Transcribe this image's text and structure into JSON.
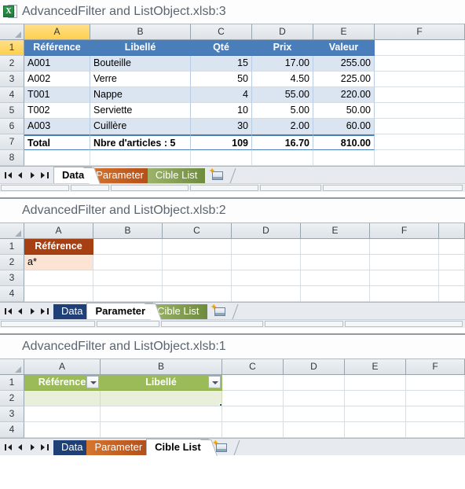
{
  "app": {
    "icon": "excel-workbook-icon"
  },
  "panels": [
    {
      "title": "AdvancedFilter and ListObject.xlsb:3",
      "columns": [
        "A",
        "B",
        "C",
        "D",
        "E",
        "F"
      ],
      "rows": [
        "1",
        "2",
        "3",
        "4",
        "5",
        "6",
        "7",
        "8"
      ],
      "table": {
        "headers": [
          "Référence",
          "Libellé",
          "Qté",
          "Prix",
          "Valeur"
        ],
        "data": [
          [
            "A001",
            "Bouteille",
            "15",
            "17.00",
            "255.00"
          ],
          [
            "A002",
            "Verre",
            "50",
            "4.50",
            "225.00"
          ],
          [
            "T001",
            "Nappe",
            "4",
            "55.00",
            "220.00"
          ],
          [
            "T002",
            "Serviette",
            "10",
            "5.00",
            "50.00"
          ],
          [
            "A003",
            "Cuillère",
            "30",
            "2.00",
            "60.00"
          ]
        ],
        "total": [
          "Total",
          "Nbre d'articles :  5",
          "109",
          "16.70",
          "810.00"
        ]
      },
      "tabs": [
        {
          "label": "Data",
          "state": "active"
        },
        {
          "label": "Parameter",
          "state": "orange"
        },
        {
          "label": "Cible List",
          "state": "green"
        }
      ]
    },
    {
      "title": "AdvancedFilter and ListObject.xlsb:2",
      "columns": [
        "A",
        "B",
        "C",
        "D",
        "E",
        "F"
      ],
      "rows": [
        "1",
        "2",
        "3",
        "4"
      ],
      "criteria": {
        "header": "Référence",
        "value": "a*"
      },
      "tabs": [
        {
          "label": "Data",
          "state": "blue"
        },
        {
          "label": "Parameter",
          "state": "active"
        },
        {
          "label": "Cible List",
          "state": "green"
        }
      ]
    },
    {
      "title": "AdvancedFilter and ListObject.xlsb:1",
      "columns": [
        "A",
        "B",
        "C",
        "D",
        "E",
        "F"
      ],
      "rows": [
        "1",
        "2",
        "3",
        "4"
      ],
      "listobject": {
        "headers": [
          "Référence",
          "Libellé"
        ]
      },
      "tabs": [
        {
          "label": "Data",
          "state": "blue"
        },
        {
          "label": "Parameter",
          "state": "orange"
        },
        {
          "label": "Cible List",
          "state": "active"
        }
      ]
    }
  ],
  "icons": {
    "first": "first-sheet-icon",
    "prev": "previous-sheet-icon",
    "next": "next-sheet-icon",
    "last": "last-sheet-icon",
    "insert": "insert-sheet-icon",
    "filter": "filter-dropdown-icon"
  },
  "colors": {
    "table_header_blue": "#4A7EBB",
    "band_blue": "#DBE5F1",
    "criteria_header": "#A63F12",
    "criteria_value": "#FCE4D4",
    "listobject_green": "#9BBB59",
    "listobject_body": "#EAEFDC",
    "selected_header": "#FFCF4D"
  }
}
